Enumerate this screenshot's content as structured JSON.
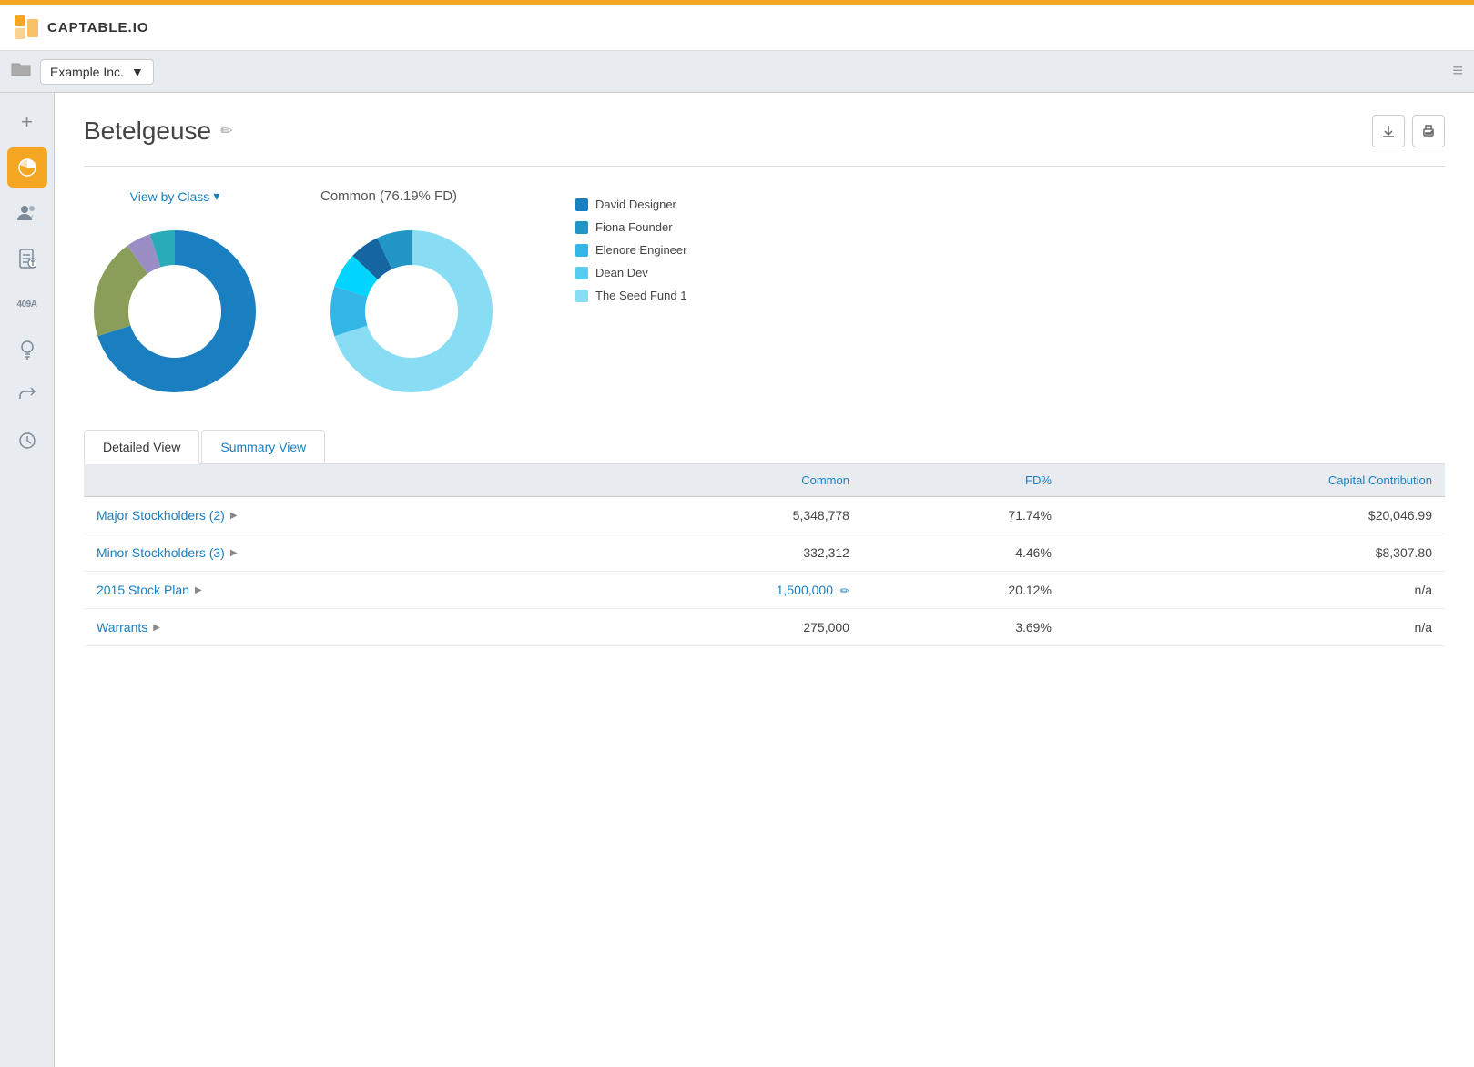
{
  "topbar": {
    "accent_color": "#f5a623"
  },
  "header": {
    "logo_text": "CAPTABLE.IO"
  },
  "toolbar": {
    "company": "Example Inc.",
    "dropdown_arrow": "▼"
  },
  "sidebar": {
    "items": [
      {
        "id": "add",
        "icon": "+",
        "active": false
      },
      {
        "id": "chart",
        "icon": "●",
        "active": true
      },
      {
        "id": "people",
        "icon": "👥",
        "active": false
      },
      {
        "id": "reports",
        "icon": "📋",
        "active": false
      },
      {
        "id": "409a",
        "icon": "409A",
        "active": false
      },
      {
        "id": "bulb",
        "icon": "💡",
        "active": false
      },
      {
        "id": "share",
        "icon": "↗",
        "active": false
      },
      {
        "id": "history",
        "icon": "⏱",
        "active": false
      }
    ]
  },
  "page": {
    "title": "Betelgeuse",
    "edit_icon": "✏",
    "download_icon": "⬇",
    "print_icon": "🖨"
  },
  "charts": {
    "view_by_class_label": "View by Class",
    "view_by_class_arrow": "▾",
    "chart1_title": "",
    "chart2_title": "Common (76.19% FD)",
    "legend": [
      {
        "label": "David Designer",
        "color": "#1a7fc1"
      },
      {
        "label": "Fiona Founder",
        "color": "#2196c4"
      },
      {
        "label": "Elenore Engineer",
        "color": "#33b5e5"
      },
      {
        "label": "Dean Dev",
        "color": "#55ccf0"
      },
      {
        "label": "The Seed Fund 1",
        "color": "#88ddf5"
      }
    ]
  },
  "tabs": [
    {
      "id": "detailed",
      "label": "Detailed View",
      "active": true
    },
    {
      "id": "summary",
      "label": "Summary View",
      "active": false
    }
  ],
  "table": {
    "headers": [
      "",
      "Common",
      "FD%",
      "Capital Contribution"
    ],
    "rows": [
      {
        "label": "Major Stockholders (2)",
        "common": "5,348,778",
        "fd_pct": "71.74%",
        "capital": "$20,046.99",
        "has_arrow": true,
        "editable": false
      },
      {
        "label": "Minor Stockholders (3)",
        "common": "332,312",
        "fd_pct": "4.46%",
        "capital": "$8,307.80",
        "has_arrow": true,
        "editable": false
      },
      {
        "label": "2015 Stock Plan",
        "common": "1,500,000",
        "fd_pct": "20.12%",
        "capital": "n/a",
        "has_arrow": true,
        "editable": true
      },
      {
        "label": "Warrants",
        "common": "275,000",
        "fd_pct": "3.69%",
        "capital": "n/a",
        "has_arrow": true,
        "editable": false
      }
    ]
  }
}
